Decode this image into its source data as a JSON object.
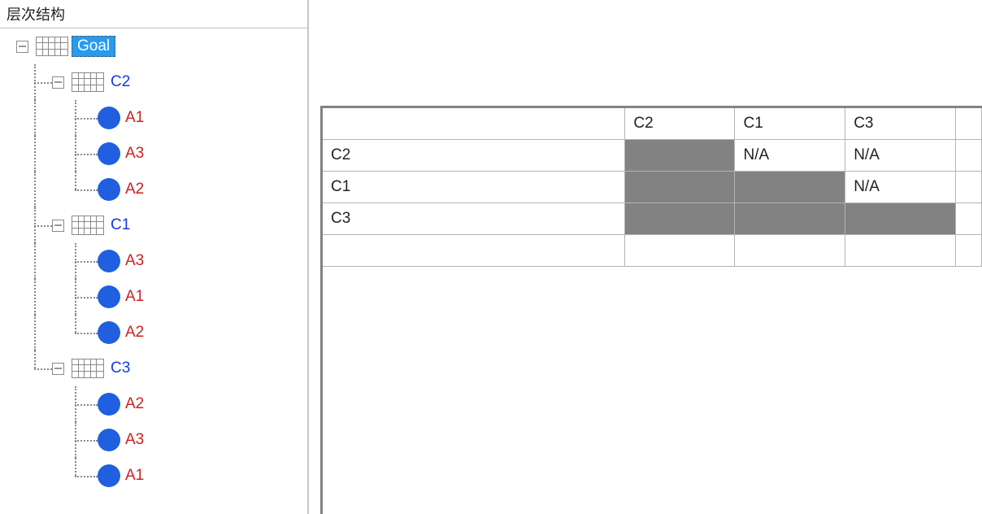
{
  "panel_title": "层次结构",
  "tree": {
    "goal": {
      "label": "Goal"
    },
    "criteria": [
      {
        "label": "C2",
        "alternatives": [
          "A1",
          "A3",
          "A2"
        ]
      },
      {
        "label": "C1",
        "alternatives": [
          "A3",
          "A1",
          "A2"
        ]
      },
      {
        "label": "C3",
        "alternatives": [
          "A2",
          "A3",
          "A1"
        ]
      }
    ]
  },
  "matrix": {
    "columns": [
      "C2",
      "C1",
      "C3"
    ],
    "rows": [
      {
        "name": "C2",
        "cells": [
          {
            "value": "",
            "shaded": true
          },
          {
            "value": "N/A",
            "shaded": false
          },
          {
            "value": "N/A",
            "shaded": false
          }
        ]
      },
      {
        "name": "C1",
        "cells": [
          {
            "value": "",
            "shaded": true
          },
          {
            "value": "",
            "shaded": true
          },
          {
            "value": "N/A",
            "shaded": false
          }
        ]
      },
      {
        "name": "C3",
        "cells": [
          {
            "value": "",
            "shaded": true
          },
          {
            "value": "",
            "shaded": true
          },
          {
            "value": "",
            "shaded": true
          }
        ]
      }
    ]
  }
}
